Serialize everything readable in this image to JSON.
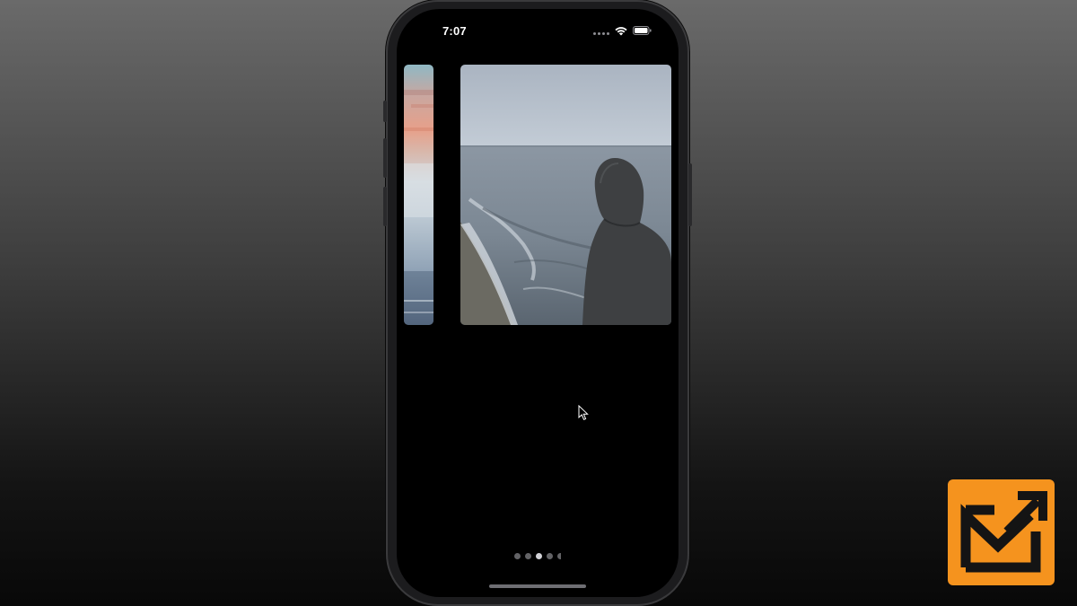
{
  "status_bar": {
    "time": "7:07",
    "icons": [
      "cellular-signal-icon",
      "wifi-icon",
      "battery-icon"
    ]
  },
  "carousel": {
    "cards": [
      {
        "position": "previous",
        "image": "sunset-beach-photo"
      },
      {
        "position": "current",
        "image": "hooded-person-at-shore-photo"
      }
    ],
    "pagination": {
      "active_index": 2,
      "visible_dots": 5
    }
  },
  "colors": {
    "screen_background": "#000000",
    "frame": "#1c1c1e",
    "dot_active": "#d1d1d6",
    "dot_inactive": "#636366",
    "logo_orange": "#f5931e"
  },
  "overlay": {
    "logo": "brand-logo-icon",
    "pointer": "mouse-cursor-icon"
  }
}
